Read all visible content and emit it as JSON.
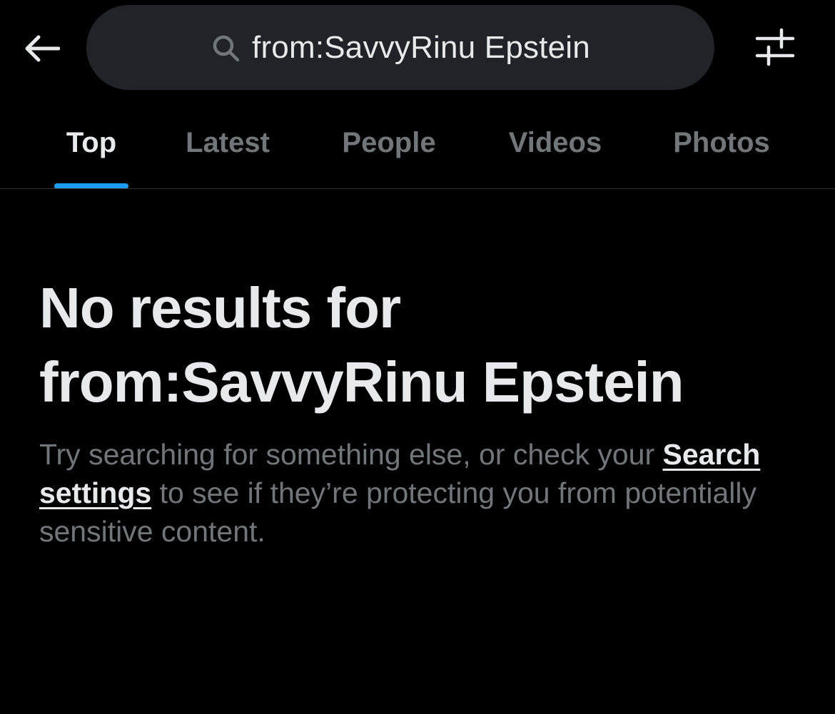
{
  "header": {
    "back_icon": "arrow-left-icon",
    "search": {
      "icon": "search-icon",
      "query": "from:SavvyRinu Epstein"
    },
    "filter_icon": "sliders-icon"
  },
  "tabs": [
    {
      "label": "Top",
      "active": true
    },
    {
      "label": "Latest",
      "active": false
    },
    {
      "label": "People",
      "active": false
    },
    {
      "label": "Videos",
      "active": false
    },
    {
      "label": "Photos",
      "active": false
    }
  ],
  "empty_state": {
    "title_line1": "No results for",
    "title_line2": "from:SavvyRinu Epstein",
    "desc_before": "Try searching for something else, or check your ",
    "link_text": "Search settings",
    "desc_after": " to see if they’re protecting you from potentially sensitive content."
  },
  "colors": {
    "background": "#000000",
    "primary_text": "#e7e9ea",
    "secondary_text": "#71767b",
    "accent": "#1d9bf0",
    "search_bg": "#202327"
  }
}
